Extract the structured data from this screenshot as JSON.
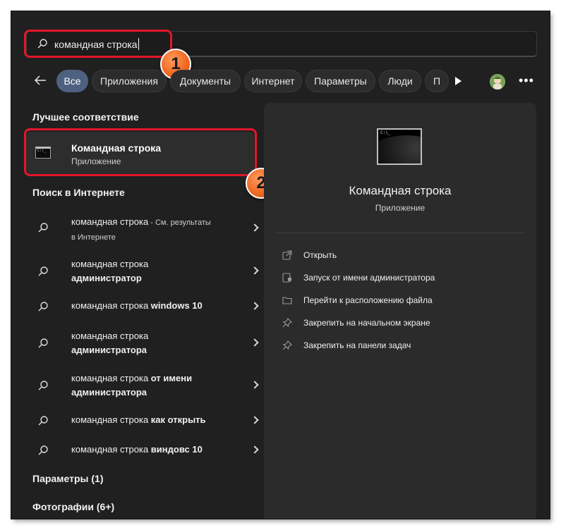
{
  "search": {
    "query": "командная строка"
  },
  "callouts": [
    "1",
    "2"
  ],
  "filters": [
    "Все",
    "Приложения",
    "Документы",
    "Интернет",
    "Параметры",
    "Люди",
    "П"
  ],
  "best_match": {
    "header": "Лучшее соответствие",
    "title": "Командная строка",
    "subtitle": "Приложение"
  },
  "web": {
    "header": "Поиск в Интернете",
    "items": [
      {
        "prefix": "командная строка",
        "bold": "",
        "suffix": " - См. результаты",
        "suffix2": "в Интернете"
      },
      {
        "prefix": "командная строка",
        "bold": "администратор"
      },
      {
        "prefix": "командная строка ",
        "bold": "windows 10"
      },
      {
        "prefix": "командная строка",
        "bold": "администратора"
      },
      {
        "prefix": "командная строка ",
        "bold": "от имени",
        "bold2": "администратора"
      },
      {
        "prefix": "командная строка ",
        "bold": "как открыть"
      },
      {
        "prefix": "командная строка ",
        "bold": "виндовс 10"
      }
    ]
  },
  "settings_header": "Параметры (1)",
  "photos_header": "Фотографии (6+)",
  "preview": {
    "title": "Командная строка",
    "subtitle": "Приложение",
    "actions": [
      {
        "label": "Открыть",
        "icon": "open-icon"
      },
      {
        "label": "Запуск от имени администратора",
        "icon": "shield-icon"
      },
      {
        "label": "Перейти к расположению файла",
        "icon": "folder-icon"
      },
      {
        "label": "Закрепить на начальном экране",
        "icon": "pin-icon"
      },
      {
        "label": "Закрепить на панели задач",
        "icon": "pin-icon"
      }
    ]
  },
  "colors": {
    "background": "#202020",
    "panel": "#2b2b2b",
    "accent_chip": "#4e6180",
    "highlight": "#e3162b",
    "callout": "#f06a23"
  }
}
